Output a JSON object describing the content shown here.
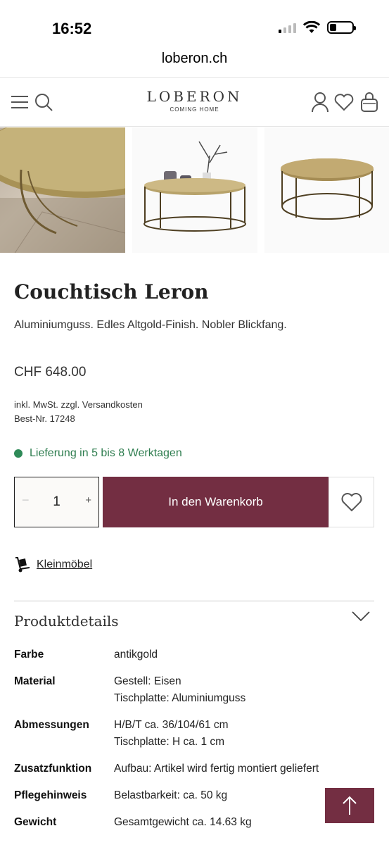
{
  "status": {
    "time": "16:52"
  },
  "browser": {
    "url": "loberon.ch"
  },
  "header": {
    "logo": "LOBERON",
    "tagline": "COMING HOME"
  },
  "product": {
    "title": "Couchtisch Leron",
    "subtitle": "Aluminiumguss. Edles Altgold-Finish. Nobler Blickfang.",
    "price": "CHF 648.00",
    "tax_note": "inkl. MwSt. zzgl. Versandkosten",
    "article_no": "Best-Nr. 17248",
    "delivery": "Lieferung in 5 bis 8 Werktagen"
  },
  "purchase": {
    "quantity": "1",
    "minus": "−",
    "plus": "+",
    "cart_label": "In den Warenkorb"
  },
  "category_link": "Kleinmöbel",
  "details": {
    "title": "Produktdetails",
    "rows": [
      {
        "label": "Farbe",
        "lines": [
          "antikgold"
        ]
      },
      {
        "label": "Material",
        "lines": [
          "Gestell: Eisen",
          "Tischplatte: Aluminiumguss"
        ]
      },
      {
        "label": "Abmessungen",
        "lines": [
          "H/B/T ca. 36/104/61 cm",
          "Tischplatte: H ca. 1 cm"
        ]
      },
      {
        "label": "Zusatzfunktion",
        "lines": [
          "Aufbau: Artikel wird fertig montiert geliefert"
        ]
      },
      {
        "label": "Pflegehinweis",
        "lines": [
          "Belastbarkeit: ca. 50 kg"
        ]
      },
      {
        "label": "Gewicht",
        "lines": [
          "Gesamtgewicht ca. 14.63 kg"
        ]
      }
    ]
  },
  "colors": {
    "brand": "#732e42",
    "delivery_green": "#2e7d4f"
  },
  "icons": [
    "menu-icon",
    "search-icon",
    "account-icon",
    "heart-icon",
    "bag-icon",
    "hand-truck-icon",
    "chevron-down-icon",
    "arrow-up-icon"
  ]
}
